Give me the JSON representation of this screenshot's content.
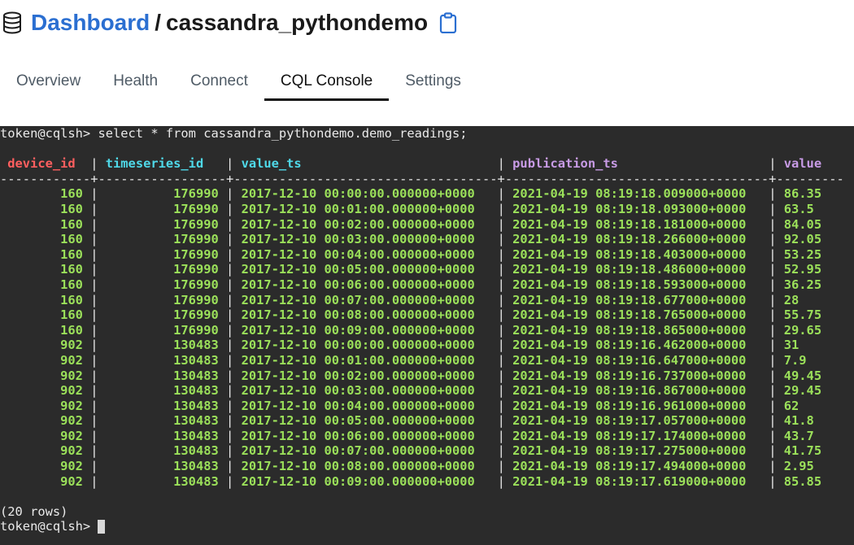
{
  "header": {
    "breadcrumb_link": "Dashboard",
    "breadcrumb_sep": "/",
    "breadcrumb_current": "cassandra_pythondemo",
    "db_icon": "database-icon",
    "copy_icon": "clipboard-icon"
  },
  "tabs": [
    {
      "label": "Overview"
    },
    {
      "label": "Health"
    },
    {
      "label": "Connect"
    },
    {
      "label": "CQL Console",
      "active": true
    },
    {
      "label": "Settings"
    }
  ],
  "console": {
    "prompt": "token@cqlsh>",
    "command": "select * from cassandra_pythondemo.demo_readings;",
    "columns": [
      "device_id",
      "timeseries_id",
      "value_ts",
      "publication_ts",
      "value"
    ],
    "rows": [
      [
        "160",
        "176990",
        "2017-12-10 00:00:00.000000+0000",
        "2021-04-19 08:19:18.009000+0000",
        "86.35"
      ],
      [
        "160",
        "176990",
        "2017-12-10 00:01:00.000000+0000",
        "2021-04-19 08:19:18.093000+0000",
        "63.5"
      ],
      [
        "160",
        "176990",
        "2017-12-10 00:02:00.000000+0000",
        "2021-04-19 08:19:18.181000+0000",
        "84.05"
      ],
      [
        "160",
        "176990",
        "2017-12-10 00:03:00.000000+0000",
        "2021-04-19 08:19:18.266000+0000",
        "92.05"
      ],
      [
        "160",
        "176990",
        "2017-12-10 00:04:00.000000+0000",
        "2021-04-19 08:19:18.403000+0000",
        "53.25"
      ],
      [
        "160",
        "176990",
        "2017-12-10 00:05:00.000000+0000",
        "2021-04-19 08:19:18.486000+0000",
        "52.95"
      ],
      [
        "160",
        "176990",
        "2017-12-10 00:06:00.000000+0000",
        "2021-04-19 08:19:18.593000+0000",
        "36.25"
      ],
      [
        "160",
        "176990",
        "2017-12-10 00:07:00.000000+0000",
        "2021-04-19 08:19:18.677000+0000",
        "28"
      ],
      [
        "160",
        "176990",
        "2017-12-10 00:08:00.000000+0000",
        "2021-04-19 08:19:18.765000+0000",
        "55.75"
      ],
      [
        "160",
        "176990",
        "2017-12-10 00:09:00.000000+0000",
        "2021-04-19 08:19:18.865000+0000",
        "29.65"
      ],
      [
        "902",
        "130483",
        "2017-12-10 00:00:00.000000+0000",
        "2021-04-19 08:19:16.462000+0000",
        "31"
      ],
      [
        "902",
        "130483",
        "2017-12-10 00:01:00.000000+0000",
        "2021-04-19 08:19:16.647000+0000",
        "7.9"
      ],
      [
        "902",
        "130483",
        "2017-12-10 00:02:00.000000+0000",
        "2021-04-19 08:19:16.737000+0000",
        "49.45"
      ],
      [
        "902",
        "130483",
        "2017-12-10 00:03:00.000000+0000",
        "2021-04-19 08:19:16.867000+0000",
        "29.45"
      ],
      [
        "902",
        "130483",
        "2017-12-10 00:04:00.000000+0000",
        "2021-04-19 08:19:16.961000+0000",
        "62"
      ],
      [
        "902",
        "130483",
        "2017-12-10 00:05:00.000000+0000",
        "2021-04-19 08:19:17.057000+0000",
        "41.8"
      ],
      [
        "902",
        "130483",
        "2017-12-10 00:06:00.000000+0000",
        "2021-04-19 08:19:17.174000+0000",
        "43.7"
      ],
      [
        "902",
        "130483",
        "2017-12-10 00:07:00.000000+0000",
        "2021-04-19 08:19:17.275000+0000",
        "41.75"
      ],
      [
        "902",
        "130483",
        "2017-12-10 00:08:00.000000+0000",
        "2021-04-19 08:19:17.494000+0000",
        "2.95"
      ],
      [
        "902",
        "130483",
        "2017-12-10 00:09:00.000000+0000",
        "2021-04-19 08:19:17.619000+0000",
        "85.85"
      ]
    ],
    "row_count": "(20 rows)",
    "colors": {
      "device_id": "#ff5f5f",
      "timeseries_id": "#4fd8e8",
      "value_ts": "#4fd8e8",
      "publication_ts": "#c89be6",
      "value": "#c89be6",
      "values": "#9be05a"
    }
  }
}
